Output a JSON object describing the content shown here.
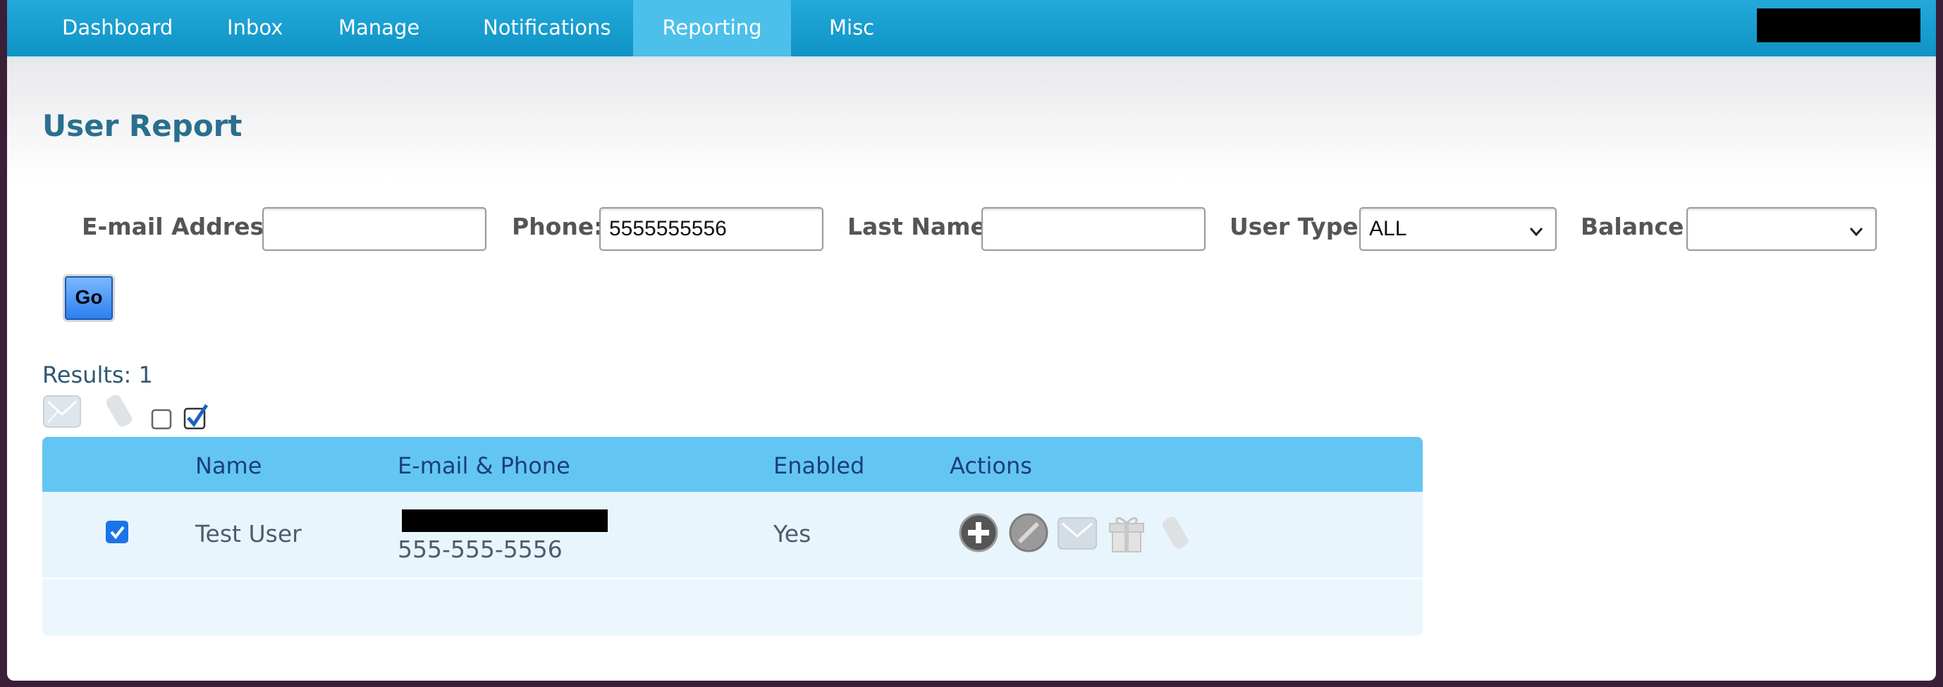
{
  "nav": {
    "items": [
      {
        "label": "Dashboard"
      },
      {
        "label": "Inbox"
      },
      {
        "label": "Manage"
      },
      {
        "label": "Notifications"
      },
      {
        "label": "Reporting"
      },
      {
        "label": "Misc"
      }
    ],
    "active": "Reporting"
  },
  "page": {
    "title": "User Report"
  },
  "filters": {
    "email": {
      "label": "E-mail Address:",
      "value": ""
    },
    "phone": {
      "label": "Phone:",
      "value": "5555555556"
    },
    "last_name": {
      "label": "Last Name:",
      "value": ""
    },
    "user_type": {
      "label": "User Type:",
      "value": "ALL"
    },
    "balance": {
      "label": "Balance:",
      "value": ""
    },
    "go_label": "Go"
  },
  "results": {
    "text": "Results: 1"
  },
  "toolbar": {
    "icons": [
      "envelope-icon",
      "tag-icon",
      "checkbox-unchecked-icon",
      "checkbox-checked-icon"
    ]
  },
  "table": {
    "headers": {
      "name": "Name",
      "contact": "E-mail & Phone",
      "enabled": "Enabled",
      "actions": "Actions"
    },
    "rows": [
      {
        "selected": true,
        "name": "Test User",
        "phone": "555-555-5556",
        "enabled": "Yes",
        "actions": [
          "plus-icon",
          "disable-icon",
          "envelope-icon",
          "gift-icon",
          "tag-icon"
        ]
      }
    ]
  },
  "colors": {
    "nav_bg": "#1aa0d2",
    "nav_active": "#4cc0ea",
    "title": "#2a6f8e",
    "table_header": "#63c6f2",
    "table_row": "#e9f5fc"
  }
}
